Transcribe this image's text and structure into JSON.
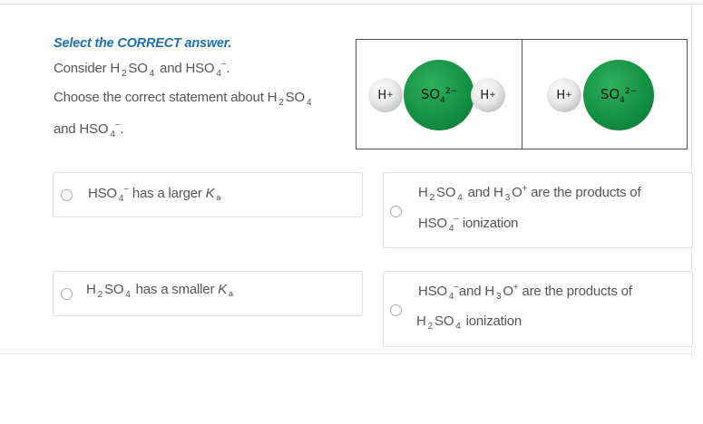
{
  "instruction": "Select the CORRECT answer.",
  "question": {
    "consider_prefix": "Consider ",
    "and_word": " and ",
    "choose_prefix": "Choose the correct statement about ",
    "continuation": "and "
  },
  "figure": {
    "left_panel": {
      "h_label": "H⁺",
      "so4_label": "SO₄²⁻"
    },
    "right_panel": {
      "h_label": "H⁺",
      "so4_label": "SO₄²⁻"
    },
    "sphere_colors": {
      "sulfate": "#139244",
      "hydrogen": "#d9d9d9"
    }
  },
  "options": [
    {
      "text_a": "has a larger ",
      "ka": "K"
    },
    {
      "text_a": "and",
      "text_b": "are the products of",
      "text_c": "ionization"
    },
    {
      "text_a": "has a smaller ",
      "ka": "K"
    },
    {
      "text_a": "and",
      "text_b": "are the products of",
      "text_c": "ionization"
    }
  ],
  "formulas": {
    "h2so4": "H₂SO₄",
    "hso4": "HSO₄⁻",
    "h3o": "H₃O⁺",
    "ka_sub": "a"
  },
  "colors": {
    "accent": "#1f6fb2",
    "text": "#555555",
    "border": "#dedede"
  }
}
